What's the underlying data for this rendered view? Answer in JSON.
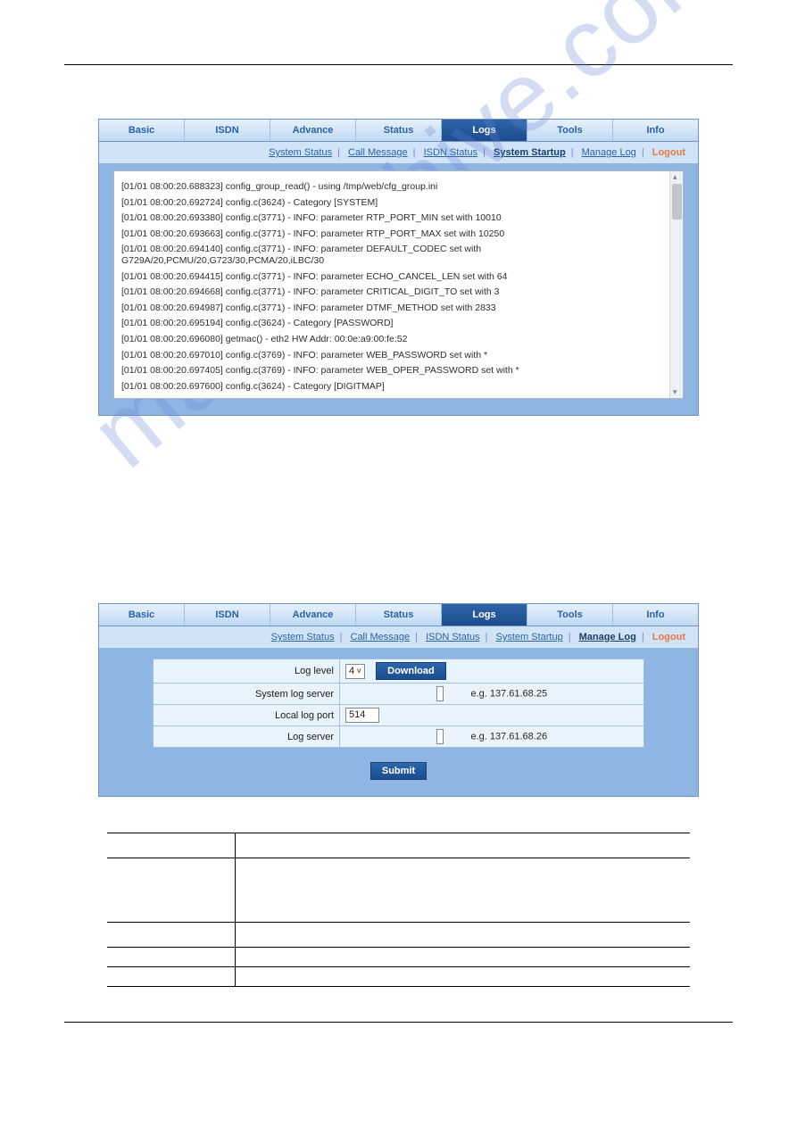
{
  "watermark": "manualshive.com",
  "tabs": [
    "Basic",
    "ISDN",
    "Advance",
    "Status",
    "Logs",
    "Tools",
    "Info"
  ],
  "active_tab_index": 4,
  "shot1": {
    "subnav": {
      "items": [
        "System Status",
        "Call Message",
        "ISDN Status",
        "System Startup",
        "Manage Log"
      ],
      "active_index": 3,
      "logout": "Logout"
    },
    "log_lines": [
      "[01/01 08:00:20.688323] config_group_read() - using /tmp/web/cfg_group.ini",
      "[01/01 08:00:20.692724] config.c(3624) - Category [SYSTEM]",
      "[01/01 08:00:20.693380] config.c(3771) - INFO: parameter RTP_PORT_MIN set with 10010",
      "[01/01 08:00:20.693663] config.c(3771) - INFO: parameter RTP_PORT_MAX set with 10250",
      "[01/01 08:00:20.694140] config.c(3771) - INFO: parameter DEFAULT_CODEC set with G729A/20,PCMU/20,G723/30,PCMA/20,iLBC/30",
      "[01/01 08:00:20.694415] config.c(3771) - INFO: parameter ECHO_CANCEL_LEN set with 64",
      "[01/01 08:00:20.694668] config.c(3771) - INFO: parameter CRITICAL_DIGIT_TO set with 3",
      "[01/01 08:00:20.694987] config.c(3771) - INFO: parameter DTMF_METHOD set with 2833",
      "[01/01 08:00:20.695194] config.c(3624) - Category [PASSWORD]",
      "[01/01 08:00:20.696080] getmac() - eth2 HW Addr: 00:0e:a9:00:fe:52",
      "[01/01 08:00:20.697010] config.c(3769) - INFO: parameter WEB_PASSWORD set with *",
      "[01/01 08:00:20.697405] config.c(3769) - INFO: parameter WEB_OPER_PASSWORD set with *",
      "[01/01 08:00:20.697600] config.c(3624) - Category [DIGITMAP]"
    ]
  },
  "shot2": {
    "subnav": {
      "items": [
        "System Status",
        "Call Message",
        "ISDN Status",
        "System Startup",
        "Manage Log"
      ],
      "active_index": 4,
      "logout": "Logout"
    },
    "rows": {
      "log_level_label": "Log level",
      "log_level_value": "4",
      "download_btn": "Download",
      "system_log_server_label": "System log server",
      "system_log_server_hint": "e.g. 137.61.68.25",
      "local_log_port_label": "Local log port",
      "local_log_port_value": "514",
      "log_server_label": "Log server",
      "log_server_hint": "e.g. 137.61.68.26"
    },
    "submit_btn": "Submit"
  }
}
